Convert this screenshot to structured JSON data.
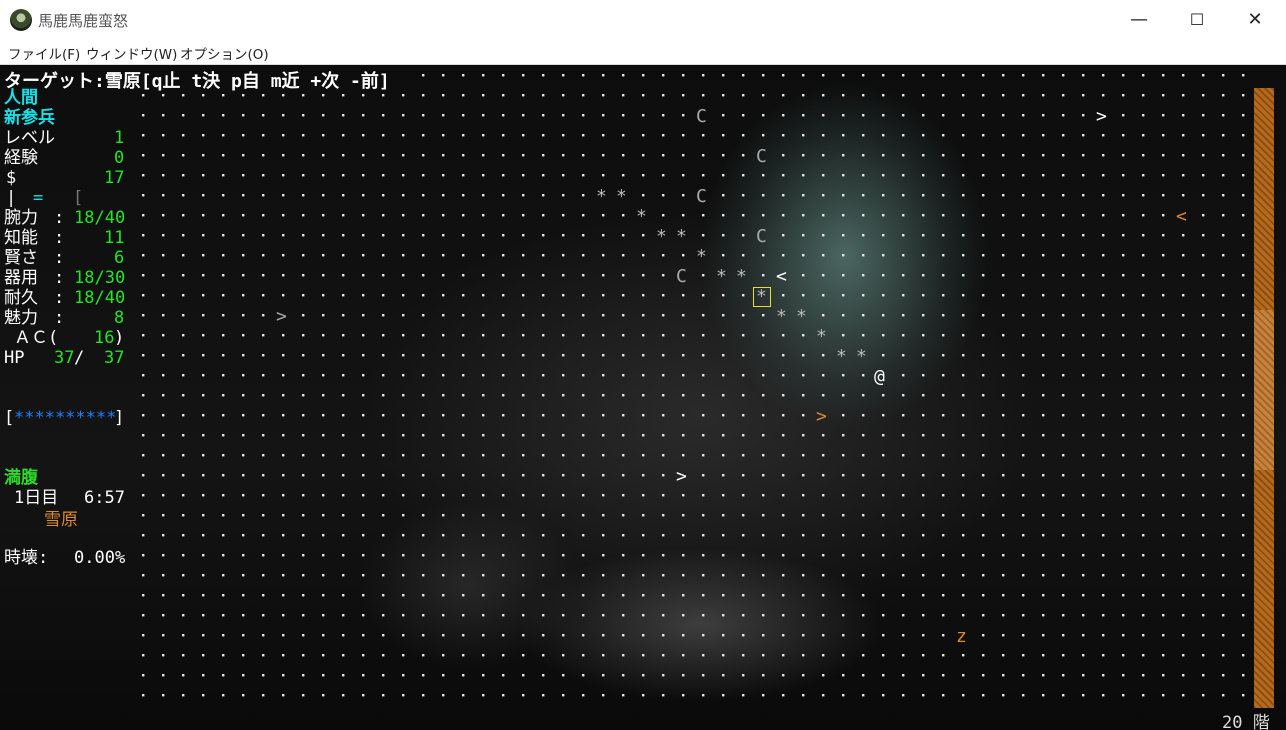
{
  "window": {
    "title": "馬鹿馬鹿蛮怒",
    "app_icon": "game-app-icon",
    "controls": {
      "minimize": "—",
      "maximize": "☐",
      "close": "✕"
    }
  },
  "menu": {
    "file": "ファイル(F)",
    "window": "ウィンドウ(W)",
    "options": "オプション(O)"
  },
  "target_line": "ターゲット:雪原[q止 t決 p自 m近 +次 -前]",
  "character": {
    "race": "人間",
    "title": "新参兵",
    "level_label": "レベル",
    "level": "1",
    "exp_label": "経験",
    "exp": "0",
    "gold_label": "$",
    "gold": "17",
    "equip_symbols": [
      "|",
      "=",
      "["
    ],
    "str_label": "腕力",
    "str": "18/40",
    "int_label": "知能",
    "int": "11",
    "wis_label": "賢さ",
    "wis": "6",
    "dex_label": "器用",
    "dex": "18/30",
    "con_label": "耐久",
    "con": "18/40",
    "cha_label": "魅力",
    "cha": "8",
    "ac_label": "ＡＣ(",
    "ac": "16",
    "ac_close": ")",
    "hp_label": "HP",
    "hp_cur": "37",
    "hp_sep": "/",
    "hp_max": "37",
    "health_bar": "**********",
    "hunger": "満腹",
    "day": "1日目",
    "time": "6:57",
    "location": "雪原",
    "time_rot_label": "時壊:",
    "time_rot": "0.00%"
  },
  "floor_label": "20 階",
  "colors": {
    "stat_value": "#1ee81e",
    "highlight": "#19e0e8",
    "hunger": "#2bdc2b",
    "orange": "#e08a2c",
    "health_bar": "#1a7fff",
    "cursor": "#e8e020"
  },
  "map": {
    "player": "@",
    "symbols": {
      "monster_c": "C",
      "stairs_down": ">",
      "stairs_up": "<",
      "path": "*",
      "item_z": "z"
    }
  }
}
